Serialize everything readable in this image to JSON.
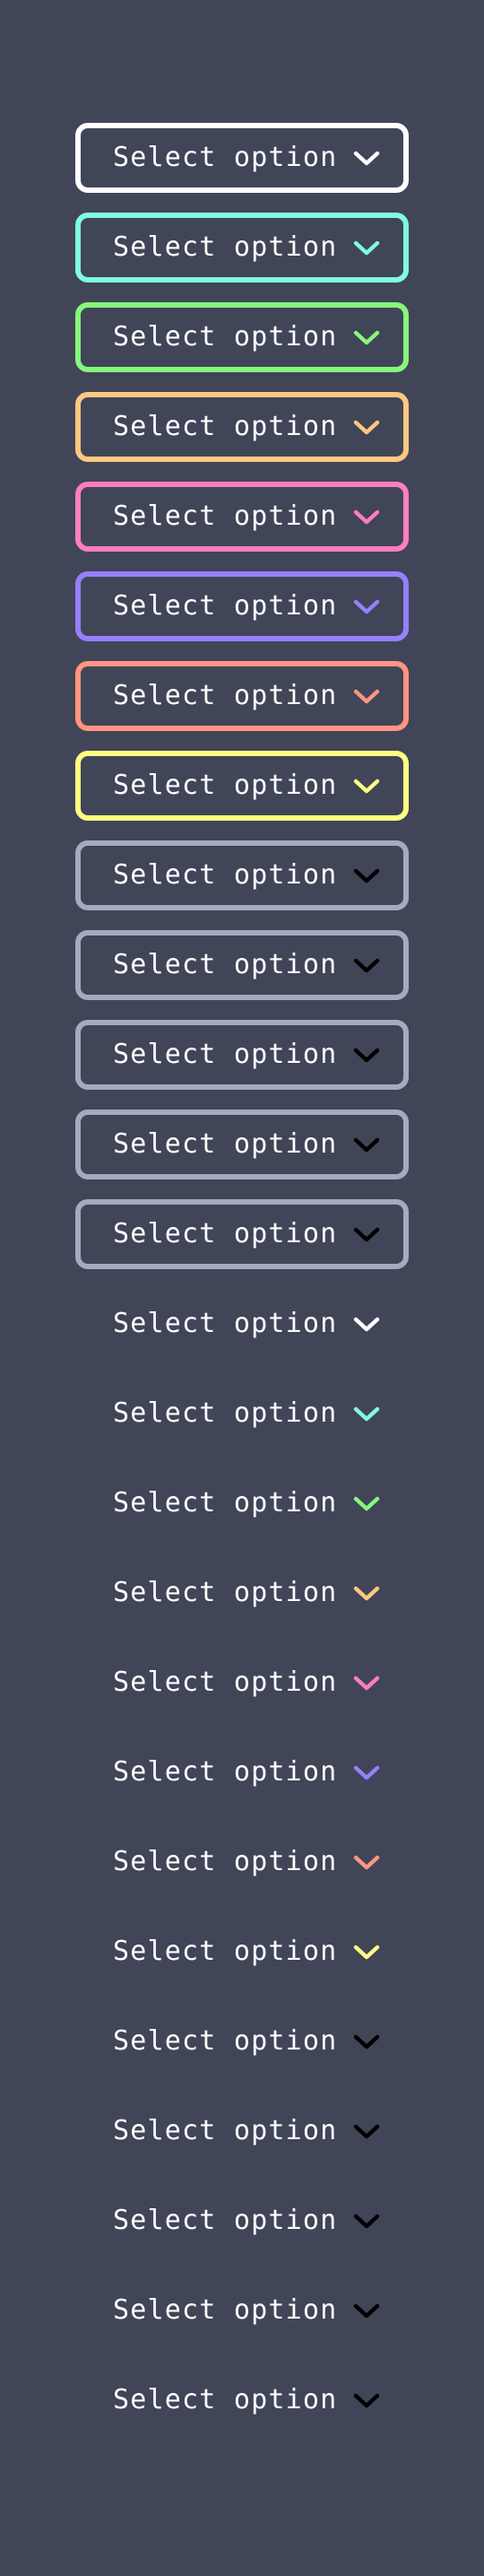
{
  "placeholder": "Select option",
  "colors": {
    "background": "#414558",
    "text": "#ffffff",
    "white": "#ffffff",
    "cyan": "#7ffbe1",
    "green": "#86f77c",
    "orange": "#fec880",
    "pink": "#ff7dc0",
    "purple": "#9580ff",
    "salmon": "#ff9580",
    "yellow": "#ffff80",
    "gray": "#a7aabf",
    "black": "#000000"
  },
  "selects": [
    {
      "variant": "bordered",
      "border": "#ffffff",
      "arrow": "#ffffff",
      "label": "Select option",
      "icon": "chevron-down-icon"
    },
    {
      "variant": "bordered",
      "border": "#7ffbe1",
      "arrow": "#7ffbe1",
      "label": "Select option",
      "icon": "chevron-down-icon"
    },
    {
      "variant": "bordered",
      "border": "#86f77c",
      "arrow": "#86f77c",
      "label": "Select option",
      "icon": "chevron-down-icon"
    },
    {
      "variant": "bordered",
      "border": "#fec880",
      "arrow": "#fec880",
      "label": "Select option",
      "icon": "chevron-down-icon"
    },
    {
      "variant": "bordered",
      "border": "#ff7dc0",
      "arrow": "#ff7dc0",
      "label": "Select option",
      "icon": "chevron-down-icon"
    },
    {
      "variant": "bordered",
      "border": "#9580ff",
      "arrow": "#9580ff",
      "label": "Select option",
      "icon": "chevron-down-icon"
    },
    {
      "variant": "bordered",
      "border": "#ff9580",
      "arrow": "#ff9580",
      "label": "Select option",
      "icon": "chevron-down-icon"
    },
    {
      "variant": "bordered",
      "border": "#ffff80",
      "arrow": "#ffff80",
      "label": "Select option",
      "icon": "chevron-down-icon"
    },
    {
      "variant": "bordered",
      "border": "#a7aabf",
      "arrow": "#000000",
      "label": "Select option",
      "icon": "chevron-down-icon"
    },
    {
      "variant": "bordered",
      "border": "#a7aabf",
      "arrow": "#000000",
      "label": "Select option",
      "icon": "chevron-down-icon"
    },
    {
      "variant": "bordered",
      "border": "#a7aabf",
      "arrow": "#000000",
      "label": "Select option",
      "icon": "chevron-down-icon"
    },
    {
      "variant": "bordered",
      "border": "#a7aabf",
      "arrow": "#000000",
      "label": "Select option",
      "icon": "chevron-down-icon"
    },
    {
      "variant": "bordered",
      "border": "#a7aabf",
      "arrow": "#000000",
      "label": "Select option",
      "icon": "chevron-down-icon"
    },
    {
      "variant": "plain",
      "border": "",
      "arrow": "#ffffff",
      "label": "Select option",
      "icon": "chevron-down-icon"
    },
    {
      "variant": "plain",
      "border": "",
      "arrow": "#7ffbe1",
      "label": "Select option",
      "icon": "chevron-down-icon"
    },
    {
      "variant": "plain",
      "border": "",
      "arrow": "#86f77c",
      "label": "Select option",
      "icon": "chevron-down-icon"
    },
    {
      "variant": "plain",
      "border": "",
      "arrow": "#fec880",
      "label": "Select option",
      "icon": "chevron-down-icon"
    },
    {
      "variant": "plain",
      "border": "",
      "arrow": "#ff7dc0",
      "label": "Select option",
      "icon": "chevron-down-icon"
    },
    {
      "variant": "plain",
      "border": "",
      "arrow": "#9580ff",
      "label": "Select option",
      "icon": "chevron-down-icon"
    },
    {
      "variant": "plain",
      "border": "",
      "arrow": "#ff9580",
      "label": "Select option",
      "icon": "chevron-down-icon"
    },
    {
      "variant": "plain",
      "border": "",
      "arrow": "#ffff80",
      "label": "Select option",
      "icon": "chevron-down-icon"
    },
    {
      "variant": "plain",
      "border": "",
      "arrow": "#000000",
      "label": "Select option",
      "icon": "chevron-down-icon"
    },
    {
      "variant": "plain",
      "border": "",
      "arrow": "#000000",
      "label": "Select option",
      "icon": "chevron-down-icon"
    },
    {
      "variant": "plain",
      "border": "",
      "arrow": "#000000",
      "label": "Select option",
      "icon": "chevron-down-icon"
    },
    {
      "variant": "plain",
      "border": "",
      "arrow": "#000000",
      "label": "Select option",
      "icon": "chevron-down-icon"
    },
    {
      "variant": "plain",
      "border": "",
      "arrow": "#000000",
      "label": "Select option",
      "icon": "chevron-down-icon"
    }
  ]
}
